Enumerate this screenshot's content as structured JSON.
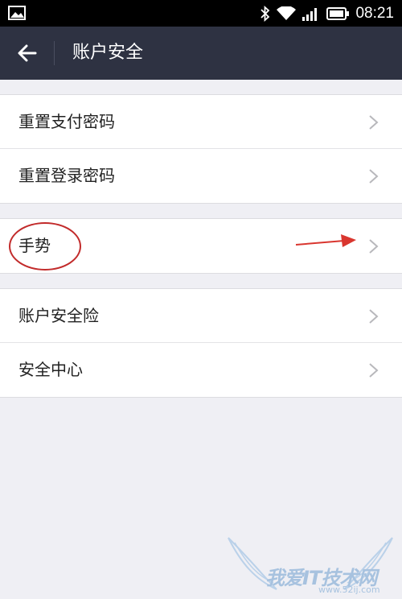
{
  "status_bar": {
    "time": "08:21",
    "icons": [
      "gallery-icon",
      "bluetooth-icon",
      "wifi-icon",
      "signal-icon",
      "battery-icon"
    ]
  },
  "header": {
    "title": "账户安全",
    "back_icon": "back-arrow-icon",
    "colors": {
      "background": "#2e3242",
      "text": "#ffffff"
    }
  },
  "groups": [
    {
      "items": [
        {
          "label": "重置支付密码"
        },
        {
          "label": "重置登录密码"
        }
      ]
    },
    {
      "items": [
        {
          "label": "手势"
        }
      ]
    },
    {
      "items": [
        {
          "label": "账户安全险"
        },
        {
          "label": "安全中心"
        }
      ]
    }
  ],
  "annotation": {
    "color": "#c22b2b",
    "circled_item": "手势"
  },
  "watermark": {
    "text": "我爱IT技术网",
    "url": "www.52ij.com"
  },
  "colors": {
    "page_background": "#efeff4",
    "row_background": "#ffffff",
    "chevron": "#b8b8bc"
  }
}
